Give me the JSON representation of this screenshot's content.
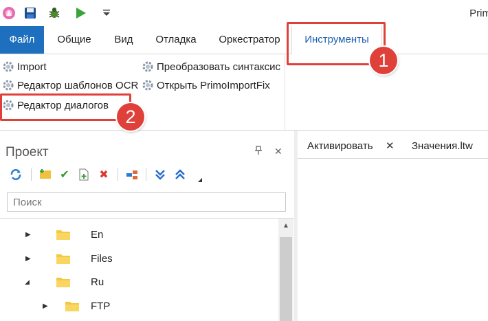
{
  "app": {
    "title_visible": "Prim"
  },
  "quick_access": [
    {
      "icon": "app-logo-icon"
    },
    {
      "icon": "save-icon"
    },
    {
      "icon": "bug-icon"
    },
    {
      "icon": "run-icon"
    },
    {
      "icon": "dropdown-icon"
    }
  ],
  "tabs": {
    "file": "Файл",
    "general": "Общие",
    "view": "Вид",
    "debug": "Отладка",
    "orchestrator": "Оркестратор",
    "tools": "Инструменты"
  },
  "ribbon": {
    "import": "Import",
    "ocr_template_editor": "Редактор шаблонов OCR",
    "dialog_editor": "Редактор диалогов",
    "convert_syntax": "Преобразовать синтаксис",
    "open_primoimportfix": "Открыть PrimoImportFix"
  },
  "callouts": {
    "one": "1",
    "two": "2"
  },
  "project_panel": {
    "title": "Проект",
    "pin": "⊿",
    "close": "✕",
    "search_placeholder": "Поиск",
    "tree": [
      {
        "label": "En",
        "expanded": false,
        "level": 0
      },
      {
        "label": "Files",
        "expanded": false,
        "level": 0
      },
      {
        "label": "Ru",
        "expanded": true,
        "level": 0
      },
      {
        "label": "FTP",
        "expanded": false,
        "level": 1
      }
    ]
  },
  "doc_tabs": {
    "activate": "Активировать",
    "close": "✕",
    "values": "Значения.ltw"
  },
  "colors": {
    "accent": "#1f6fbf",
    "callout": "#e0403a",
    "folder": "#f5c842"
  }
}
